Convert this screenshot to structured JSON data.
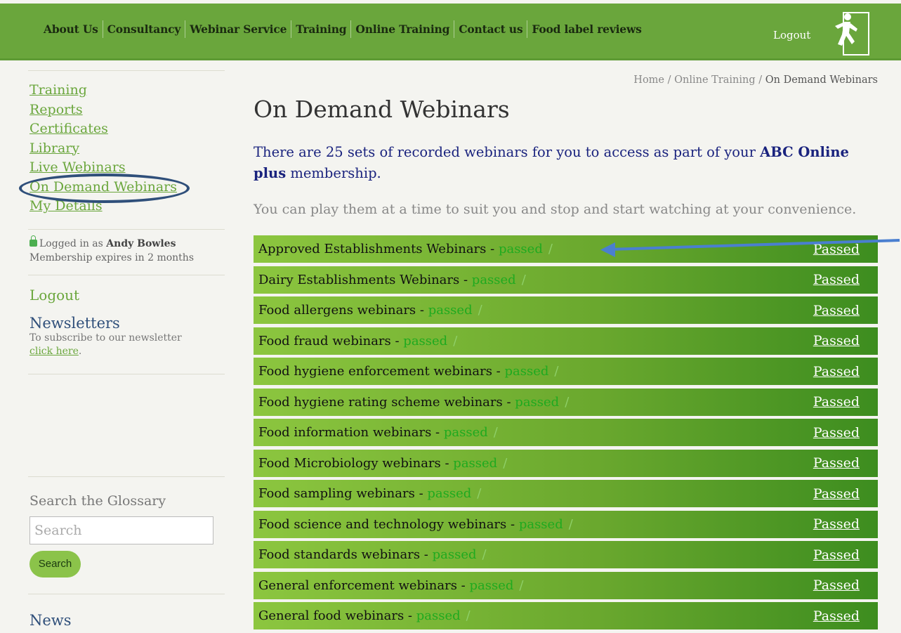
{
  "nav": {
    "items": [
      "About Us",
      "Consultancy",
      "Webinar Service",
      "Training",
      "Online Training",
      "Contact us",
      "Food label reviews"
    ],
    "logout": "Logout"
  },
  "sidebar": {
    "links": [
      "Training",
      "Reports",
      "Certificates",
      "Library",
      "Live Webinars",
      "On Demand Webinars",
      "My Details"
    ],
    "logged_in_prefix": "Logged in as",
    "user": "Andy Bowles",
    "membership": "Membership expires in 2 months",
    "logout": "Logout",
    "newsletters_title": "Newsletters",
    "newsletters_text": "To subscribe to our newsletter",
    "newsletters_link": "click here",
    "glossary_label": "Search the Glossary",
    "search_placeholder": "Search",
    "search_button": "Search",
    "news_title": "News"
  },
  "breadcrumb": [
    "Home",
    "Online Training",
    "On Demand Webinars"
  ],
  "page": {
    "title": "On Demand Webinars",
    "intro_a": "There are 25 sets of recorded webinars for you to access as part of your ",
    "intro_b": "ABC Online plus",
    "intro_c": " membership.",
    "note": "You can play them at a time to suit you and stop and start watching at your convenience."
  },
  "webinars": [
    {
      "name": "Approved Establishments Webinars",
      "status": "passed",
      "link": "Passed"
    },
    {
      "name": "Dairy Establishments Webinars",
      "status": "passed",
      "link": "Passed"
    },
    {
      "name": "Food allergens webinars",
      "status": "passed",
      "link": "Passed"
    },
    {
      "name": "Food fraud webinars",
      "status": "passed",
      "link": "Passed"
    },
    {
      "name": "Food hygiene enforcement webinars",
      "status": "passed",
      "link": "Passed"
    },
    {
      "name": "Food hygiene rating scheme webinars",
      "status": "passed",
      "link": "Passed"
    },
    {
      "name": "Food information webinars",
      "status": "passed",
      "link": "Passed"
    },
    {
      "name": "Food Microbiology webinars",
      "status": "passed",
      "link": "Passed"
    },
    {
      "name": "Food sampling webinars",
      "status": "passed",
      "link": "Passed"
    },
    {
      "name": "Food science and technology webinars",
      "status": "passed",
      "link": "Passed"
    },
    {
      "name": "Food standards webinars",
      "status": "passed",
      "link": "Passed"
    },
    {
      "name": "General enforcement webinars",
      "status": "passed",
      "link": "Passed"
    },
    {
      "name": "General food webinars",
      "status": "passed",
      "link": "Passed"
    }
  ],
  "colors": {
    "brand_green": "#6aa63c",
    "annotation_blue": "#2f4f7a",
    "arrow_blue": "#4a7fd0"
  },
  "icons": {
    "exit": "exit-person-icon",
    "lock": "lock-icon",
    "arrow": "annotation-arrow-icon"
  }
}
